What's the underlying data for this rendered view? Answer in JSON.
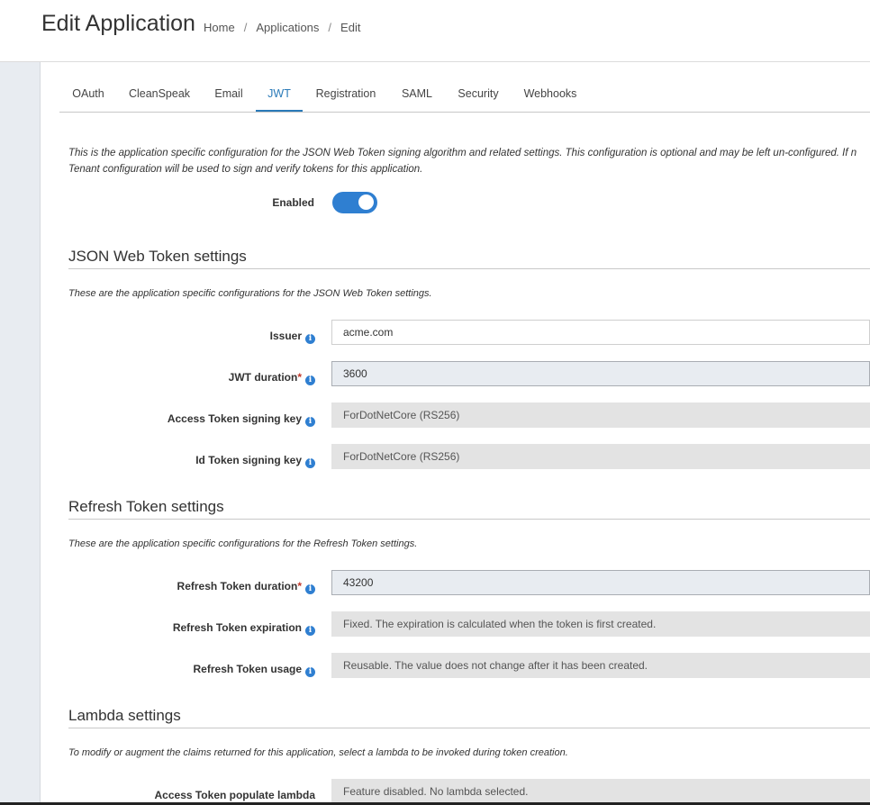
{
  "header": {
    "title": "Edit Application",
    "breadcrumb": [
      "Home",
      "Applications",
      "Edit"
    ]
  },
  "tabs": [
    {
      "label": "OAuth",
      "active": false
    },
    {
      "label": "CleanSpeak",
      "active": false
    },
    {
      "label": "Email",
      "active": false
    },
    {
      "label": "JWT",
      "active": true
    },
    {
      "label": "Registration",
      "active": false
    },
    {
      "label": "SAML",
      "active": false
    },
    {
      "label": "Security",
      "active": false
    },
    {
      "label": "Webhooks",
      "active": false
    }
  ],
  "intro": {
    "line1": "This is the application specific configuration for the JSON Web Token signing algorithm and related settings. This configuration is optional and may be left un-configured. If n",
    "line2": "Tenant configuration will be used to sign and verify tokens for this application."
  },
  "enabled": {
    "label": "Enabled",
    "value": true
  },
  "jwt_settings": {
    "title": "JSON Web Token settings",
    "description": "These are the application specific configurations for the JSON Web Token settings.",
    "issuer": {
      "label": "Issuer",
      "value": "acme.com"
    },
    "jwt_duration": {
      "label": "JWT duration",
      "required_mark": "*",
      "value": "3600"
    },
    "access_token_key": {
      "label": "Access Token signing key",
      "value": "ForDotNetCore (RS256)"
    },
    "id_token_key": {
      "label": "Id Token signing key",
      "value": "ForDotNetCore (RS256)"
    }
  },
  "refresh_settings": {
    "title": "Refresh Token settings",
    "description": "These are the application specific configurations for the Refresh Token settings.",
    "duration": {
      "label": "Refresh Token duration",
      "required_mark": "*",
      "value": "43200"
    },
    "expiration": {
      "label": "Refresh Token expiration",
      "value": "Fixed. The expiration is calculated when the token is first created."
    },
    "usage": {
      "label": "Refresh Token usage",
      "value": "Reusable. The value does not change after it has been created."
    }
  },
  "lambda_settings": {
    "title": "Lambda settings",
    "description": "To modify or augment the claims returned for this application, select a lambda to be invoked during token creation.",
    "access_lambda": {
      "label": "Access Token populate lambda",
      "value": "Feature disabled. No lambda selected."
    }
  },
  "icons": {
    "info": "i",
    "accent_color": "#2f7fd1",
    "required_color": "#c0392b"
  }
}
